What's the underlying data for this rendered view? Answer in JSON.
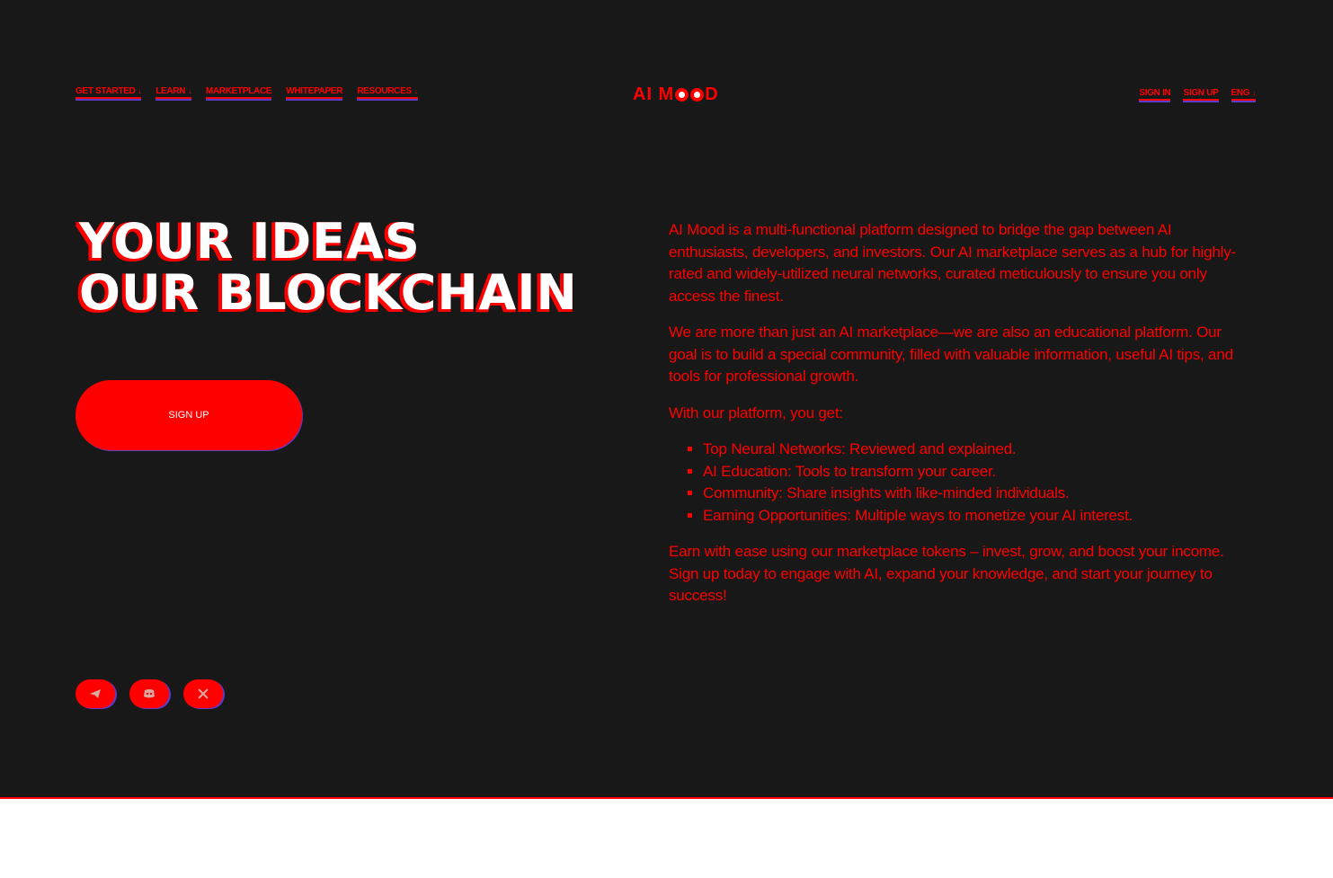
{
  "nav": {
    "left": [
      {
        "label": "GET STARTED",
        "dropdown": true
      },
      {
        "label": "LEARN",
        "dropdown": true
      },
      {
        "label": "MARKETPLACE",
        "dropdown": false
      },
      {
        "label": "WHITEPAPER",
        "dropdown": false
      },
      {
        "label": "RESOURCES",
        "dropdown": true
      }
    ],
    "logo": {
      "prefix": "AI M",
      "suffix": "D"
    },
    "right": [
      {
        "label": "SIGN IN",
        "dropdown": false
      },
      {
        "label": "SIGN UP",
        "dropdown": false
      },
      {
        "label": "ENG",
        "dropdown": true
      }
    ]
  },
  "hero": {
    "headline_line1": "YOUR IDEAS",
    "headline_line2": "OUR BLOCKCHAIN",
    "cta_label": "SIGN UP"
  },
  "description": {
    "p1": "AI Mood is a multi-functional platform designed to bridge the gap between AI enthusiasts, developers, and investors. Our AI marketplace serves as a hub for highly-rated and widely-utilized neural networks, curated meticulously to ensure you only access the finest.",
    "p2": "We are more than just an AI marketplace—we are also an educational platform. Our goal is to build a special community, filled with valuable information, useful AI tips, and tools for professional growth.",
    "p3": "With our platform, you get:",
    "bullets": [
      "Top Neural Networks: Reviewed and explained.",
      "AI Education: Tools to transform your career.",
      "Community: Share insights with like-minded individuals.",
      "Earning Opportunities: Multiple ways to monetize your AI interest."
    ],
    "p4": "Earn with ease using our marketplace tokens – invest, grow, and boost your income.",
    "p5": "Sign up today to engage with AI, expand your knowledge, and start your journey to success!"
  },
  "socials": [
    {
      "icon": "telegram-icon"
    },
    {
      "icon": "discord-icon"
    },
    {
      "icon": "x-twitter-icon"
    }
  ],
  "colors": {
    "background": "#181818",
    "accent": "#ff0000",
    "shadow": "#5a3cc8",
    "text_light": "#ffffff"
  }
}
